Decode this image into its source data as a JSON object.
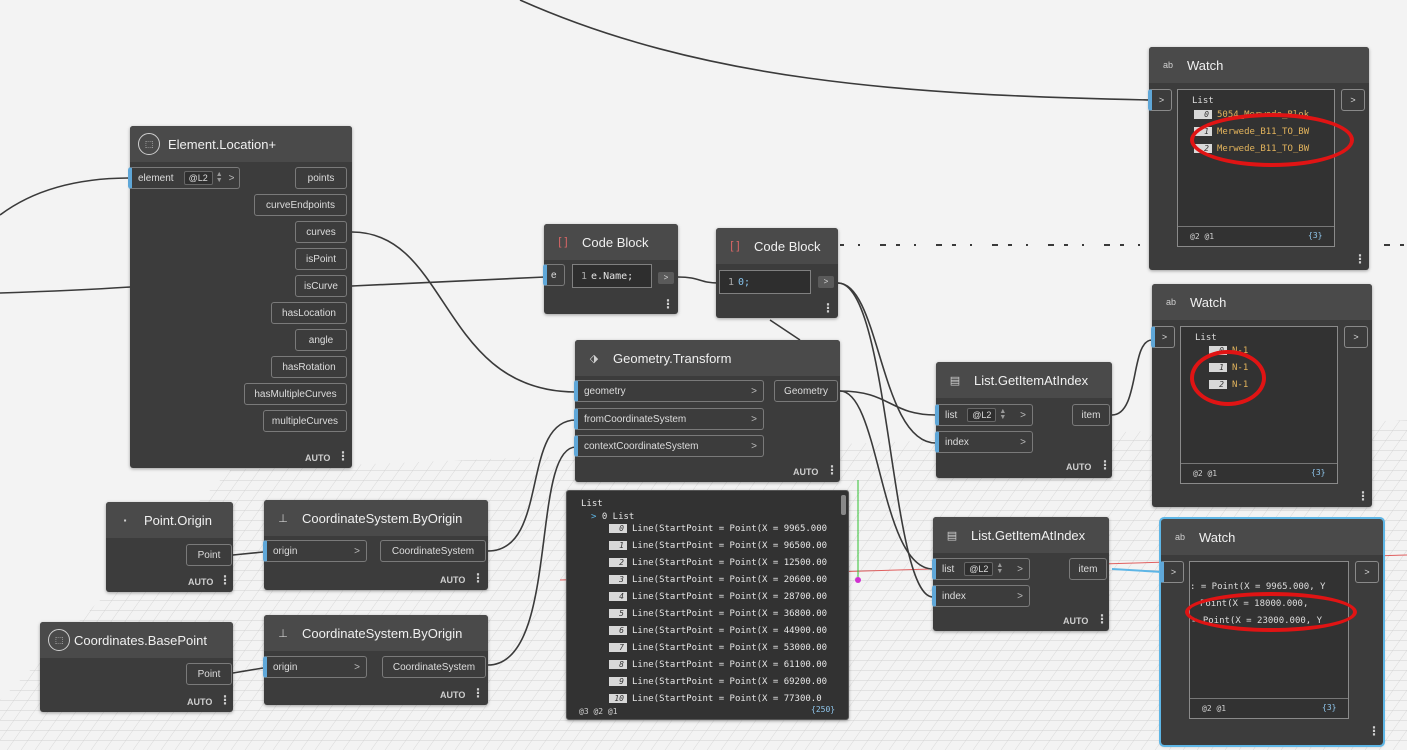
{
  "nodes": {
    "element_location": {
      "title": "Element.Location+",
      "input": "element",
      "lacing": "@L2",
      "outputs": [
        "points",
        "curveEndpoints",
        "curves",
        "isPoint",
        "isCurve",
        "hasLocation",
        "angle",
        "hasRotation",
        "hasMultipleCurves",
        "multipleCurves"
      ],
      "auto": "AUTO"
    },
    "code_block_1": {
      "title": "Code Block",
      "input": "e",
      "line": "1",
      "code": "e.Name;"
    },
    "code_block_2": {
      "title": "Code Block",
      "line": "1",
      "code": "0;"
    },
    "geometry_transform": {
      "title": "Geometry.Transform",
      "inputs": [
        "geometry",
        "fromCoordinateSystem",
        "contextCoordinateSystem"
      ],
      "output": "Geometry",
      "auto": "AUTO"
    },
    "get_item_1": {
      "title": "List.GetItemAtIndex",
      "inputs": [
        "list",
        "index"
      ],
      "lacing": "@L2",
      "output": "item",
      "auto": "AUTO"
    },
    "get_item_2": {
      "title": "List.GetItemAtIndex",
      "inputs": [
        "list",
        "index"
      ],
      "lacing": "@L2",
      "output": "item",
      "auto": "AUTO"
    },
    "point_origin": {
      "title": "Point.Origin",
      "output": "Point",
      "auto": "AUTO"
    },
    "coords_basepoint": {
      "title": "Coordinates.BasePoint",
      "output": "Point",
      "auto": "AUTO"
    },
    "cs_by_origin_1": {
      "title": "CoordinateSystem.ByOrigin",
      "input": "origin",
      "output": "CoordinateSystem",
      "auto": "AUTO"
    },
    "cs_by_origin_2": {
      "title": "CoordinateSystem.ByOrigin",
      "input": "origin",
      "output": "CoordinateSystem",
      "auto": "AUTO"
    },
    "watch_1": {
      "title": "Watch",
      "list_label": "List",
      "items": [
        {
          "i": "0",
          "v": "5054_Merwede_Blok"
        },
        {
          "i": "1",
          "v": "Merwede_B11_TO_BW"
        },
        {
          "i": "2",
          "v": "Merwede_B11_TO_BW"
        }
      ],
      "levels": "@2 @1",
      "count": "{3}"
    },
    "watch_2": {
      "title": "Watch",
      "list_label": "List",
      "items": [
        {
          "i": "0",
          "v": "N-1"
        },
        {
          "i": "1",
          "v": "N-1"
        },
        {
          "i": "2",
          "v": "N-1"
        }
      ],
      "levels": "@2 @1",
      "count": "{3}"
    },
    "watch_3": {
      "title": "Watch",
      "items": [
        ": = Point(X = 9965.000, Y",
        "Point(X = 18000.000, ",
        "= Point(X = 23000.000, Y"
      ],
      "levels": "@2 @1",
      "count": "{3}"
    },
    "preview": {
      "list_label": "List",
      "sub_label": "0 List",
      "rows": [
        {
          "i": "0",
          "v": "Line(StartPoint = Point(X = 9965.000"
        },
        {
          "i": "1",
          "v": "Line(StartPoint = Point(X = 96500.00"
        },
        {
          "i": "2",
          "v": "Line(StartPoint = Point(X = 12500.00"
        },
        {
          "i": "3",
          "v": "Line(StartPoint = Point(X = 20600.00"
        },
        {
          "i": "4",
          "v": "Line(StartPoint = Point(X = 28700.00"
        },
        {
          "i": "5",
          "v": "Line(StartPoint = Point(X = 36800.00"
        },
        {
          "i": "6",
          "v": "Line(StartPoint = Point(X = 44900.00"
        },
        {
          "i": "7",
          "v": "Line(StartPoint = Point(X = 53000.00"
        },
        {
          "i": "8",
          "v": "Line(StartPoint = Point(X = 61100.00"
        },
        {
          "i": "9",
          "v": "Line(StartPoint = Point(X = 69200.00"
        },
        {
          "i": "10",
          "v": "Line(StartPoint = Point(X = 77300.0"
        }
      ],
      "levels": "@3 @2 @1",
      "count": "{250}"
    }
  }
}
